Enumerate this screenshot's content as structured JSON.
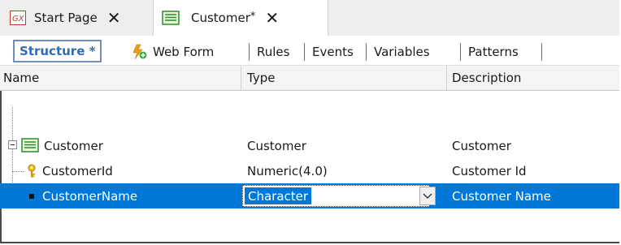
{
  "tabs": [
    {
      "icon": "gx-logo-icon",
      "label": "Start Page",
      "close": "✕"
    },
    {
      "icon": "transaction-icon",
      "label": "Customer",
      "dirty": "*",
      "close": "✕"
    }
  ],
  "subtabs": [
    "Structure *",
    "Web Form",
    "Rules",
    "Events",
    "Variables",
    "Patterns"
  ],
  "columns": [
    "Name",
    "Type",
    "Description"
  ],
  "rows": [
    {
      "name": "Customer",
      "type": "Customer",
      "description": "Customer",
      "icon": "transaction-icon"
    },
    {
      "name": "CustomerId",
      "type": "Numeric(4.0)",
      "description": "Customer Id",
      "icon": "key-icon"
    },
    {
      "name": "CustomerName",
      "type": "Character",
      "description": "Customer Name",
      "icon": "attribute-bullet-icon",
      "selected": true
    }
  ],
  "colors": {
    "accent": "#0078d7",
    "structure_text": "#2e6cb8"
  }
}
